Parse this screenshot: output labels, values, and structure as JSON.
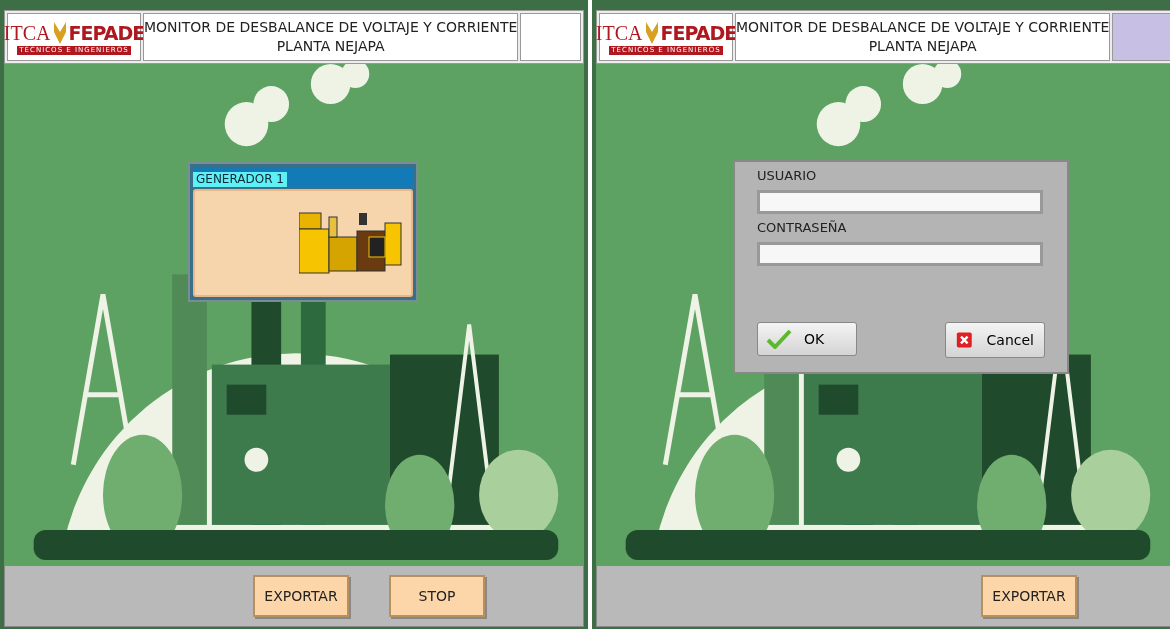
{
  "panels": [
    {
      "logo": {
        "left": "ITCA",
        "right": "FEPADE",
        "tagline": "TÉCNICOS E INGENIEROS"
      },
      "title": "MONITOR DE DESBALANCE DE VOLTAJE Y CORRIENTE",
      "subtitle": "PLANTA NEJAPA",
      "color": "#ffffff",
      "dialog": {
        "kind": "generator",
        "title": "GENERADOR 1"
      },
      "buttons": [
        "EXPORTAR",
        "STOP"
      ]
    },
    {
      "logo": {
        "left": "ITCA",
        "right": "FEPADE",
        "tagline": "TÉCNICOS E INGENIEROS"
      },
      "title": "MONITOR DE DESBALANCE DE VOLTAJE Y CORRIENTE",
      "subtitle": "PLANTA NEJAPA",
      "color": "#c8c0e4",
      "dialog": {
        "kind": "login",
        "fields": [
          {
            "label": "USUARIO"
          },
          {
            "label": "CONTRASEÑA"
          }
        ],
        "ok": "OK",
        "cancel": "Cancel"
      },
      "buttons": [
        "EXPORTAR"
      ]
    }
  ]
}
